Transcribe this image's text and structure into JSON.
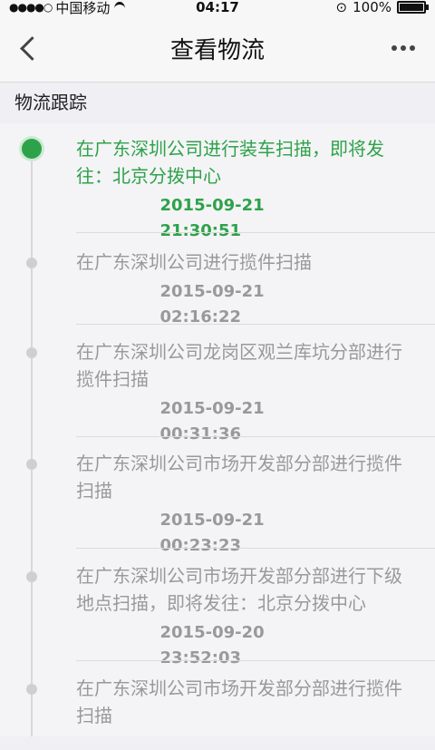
{
  "status_bar": {
    "signal": "●●●●○",
    "carrier": "中国移动",
    "time": "04:17",
    "battery": "100%"
  },
  "nav": {
    "title": "查看物流"
  },
  "section_title": "物流跟踪",
  "timeline": [
    {
      "text": "在广东深圳公司进行装车扫描，即将发往：北京分拨中心",
      "time": "2015-09-21 21:30:51",
      "active": true
    },
    {
      "text": "在广东深圳公司进行揽件扫描",
      "time": "2015-09-21 02:16:22",
      "active": false
    },
    {
      "text": "在广东深圳公司龙岗区观兰库坑分部进行揽件扫描",
      "time": "2015-09-21 00:31:36",
      "active": false
    },
    {
      "text": "在广东深圳公司市场开发部分部进行揽件扫描",
      "time": "2015-09-21 00:23:23",
      "active": false
    },
    {
      "text": "在广东深圳公司市场开发部分部进行下级地点扫描，即将发往：北京分拨中心",
      "time": "2015-09-20 23:52:03",
      "active": false
    },
    {
      "text": "在广东深圳公司市场开发部分部进行揽件扫描",
      "time": "",
      "active": false
    }
  ]
}
